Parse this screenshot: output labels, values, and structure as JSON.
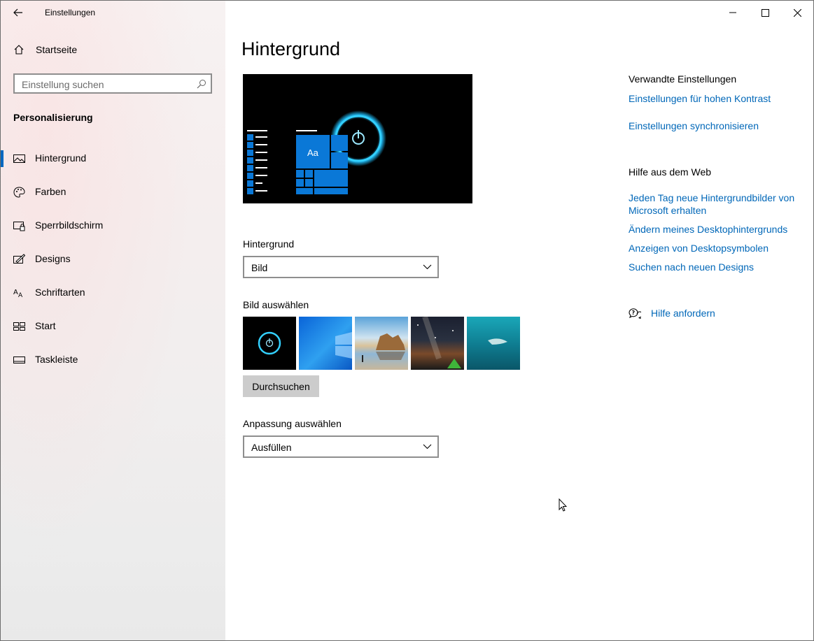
{
  "window": {
    "title": "Einstellungen"
  },
  "sidebar": {
    "home_label": "Startseite",
    "search_placeholder": "Einstellung suchen",
    "section_title": "Personalisierung",
    "items": [
      {
        "label": "Hintergrund",
        "icon": "picture-icon",
        "selected": true
      },
      {
        "label": "Farben",
        "icon": "palette-icon",
        "selected": false
      },
      {
        "label": "Sperrbildschirm",
        "icon": "lock-screen-icon",
        "selected": false
      },
      {
        "label": "Designs",
        "icon": "themes-icon",
        "selected": false
      },
      {
        "label": "Schriftarten",
        "icon": "fonts-icon",
        "selected": false
      },
      {
        "label": "Start",
        "icon": "start-icon",
        "selected": false
      },
      {
        "label": "Taskleiste",
        "icon": "taskbar-icon",
        "selected": false
      }
    ]
  },
  "main": {
    "title": "Hintergrund",
    "preview": {
      "tile_text": "Aa"
    },
    "background_label": "Hintergrund",
    "background_value": "Bild",
    "choose_picture_label": "Bild auswählen",
    "browse_label": "Durchsuchen",
    "fit_label": "Anpassung auswählen",
    "fit_value": "Ausfüllen"
  },
  "related": {
    "heading": "Verwandte Einstellungen",
    "links": [
      "Einstellungen für hohen Kontrast",
      "Einstellungen synchronisieren"
    ]
  },
  "web_help": {
    "heading": "Hilfe aus dem Web",
    "links": [
      "Jeden Tag neue Hintergrundbilder von Microsoft erhalten",
      "Ändern meines Desktophintergrunds",
      "Anzeigen von Desktopsymbolen",
      "Suchen nach neuen Designs"
    ]
  },
  "get_help_label": "Hilfe anfordern",
  "colors": {
    "accent": "#0067b8",
    "tile_blue": "#0a78d7",
    "glow": "#1fb8f2"
  }
}
